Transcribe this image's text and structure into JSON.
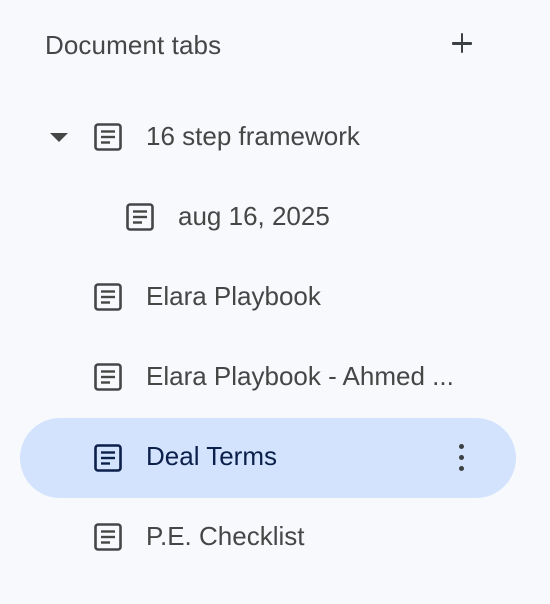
{
  "header": {
    "title": "Document tabs",
    "add_icon": "plus-icon"
  },
  "tabs": [
    {
      "label": "16 step framework",
      "icon": "document-icon",
      "expanded": true,
      "level": 0
    },
    {
      "label": "aug 16, 2025",
      "icon": "document-icon",
      "level": 1
    },
    {
      "label": "Elara Playbook",
      "icon": "document-icon",
      "level": 0
    },
    {
      "label": "Elara Playbook - Ahmed ...",
      "icon": "document-icon",
      "level": 0
    },
    {
      "label": "Deal Terms",
      "icon": "document-icon",
      "level": 0,
      "selected": true,
      "more_icon": "more-vert-icon"
    },
    {
      "label": "P.E. Checklist",
      "icon": "document-icon",
      "level": 0
    }
  ],
  "colors": {
    "background": "#f8f9fc",
    "selected_background": "#d3e3fd",
    "text": "#444746",
    "selected_text": "#0b1f4b"
  }
}
